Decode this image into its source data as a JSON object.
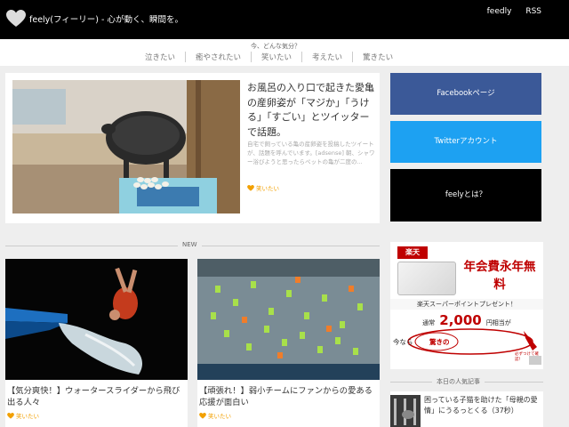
{
  "header": {
    "site_title": "feely(フィーリー) - 心が動く、瞬間を。",
    "links": [
      "feedly",
      "RSS"
    ]
  },
  "moods": {
    "question": "今、どんな気分？",
    "items": [
      "泣きたい",
      "癒やされたい",
      "笑いたい",
      "考えたい",
      "驚きたい"
    ]
  },
  "featured": {
    "title": "お風呂の入り口で起きた愛亀の産卵姿が「マジか」「うける」「すごい」とツイッターで話題。",
    "excerpt": "自宅で飼っている亀の産卵姿を投稿したツイートが、話題を呼んでいます。[adsense] 朝、シャワー浴びようと思ったらペットの亀が二度の...",
    "tag": "笑いたい"
  },
  "sidebar": {
    "facebook": "Facebookページ",
    "twitter": "Twitterアカウント",
    "about": "feelyとは？"
  },
  "section": {
    "new_label": "NEW"
  },
  "cards": [
    {
      "title": "【気分爽快！】ウォータースライダーから飛び出る人々",
      "tag": "笑いたい"
    },
    {
      "title": "【頑張れ！】弱小チームにファンからの愛ある応援が面白い",
      "tag": "笑いたい"
    }
  ],
  "ad": {
    "brand": "楽天",
    "headline": "年会費永年無料",
    "card_label": "楽天スーパーポイントプレゼント！",
    "prefix": "通常",
    "amount": "2,000",
    "suffix": "円相当が",
    "bubble_left": "今なら",
    "bubble_right": "驚きの",
    "sticker": "必ずつけて確認！"
  },
  "popular": {
    "label": "本日の人気記事",
    "items": [
      {
        "title": "困っている子猫を助けた「母親の愛情」にうるっとくる（37秒）"
      }
    ]
  },
  "colors": {
    "accent": "#f2a000",
    "facebook": "#3b5998",
    "twitter": "#1da1f2",
    "rakuten": "#bf0000"
  }
}
